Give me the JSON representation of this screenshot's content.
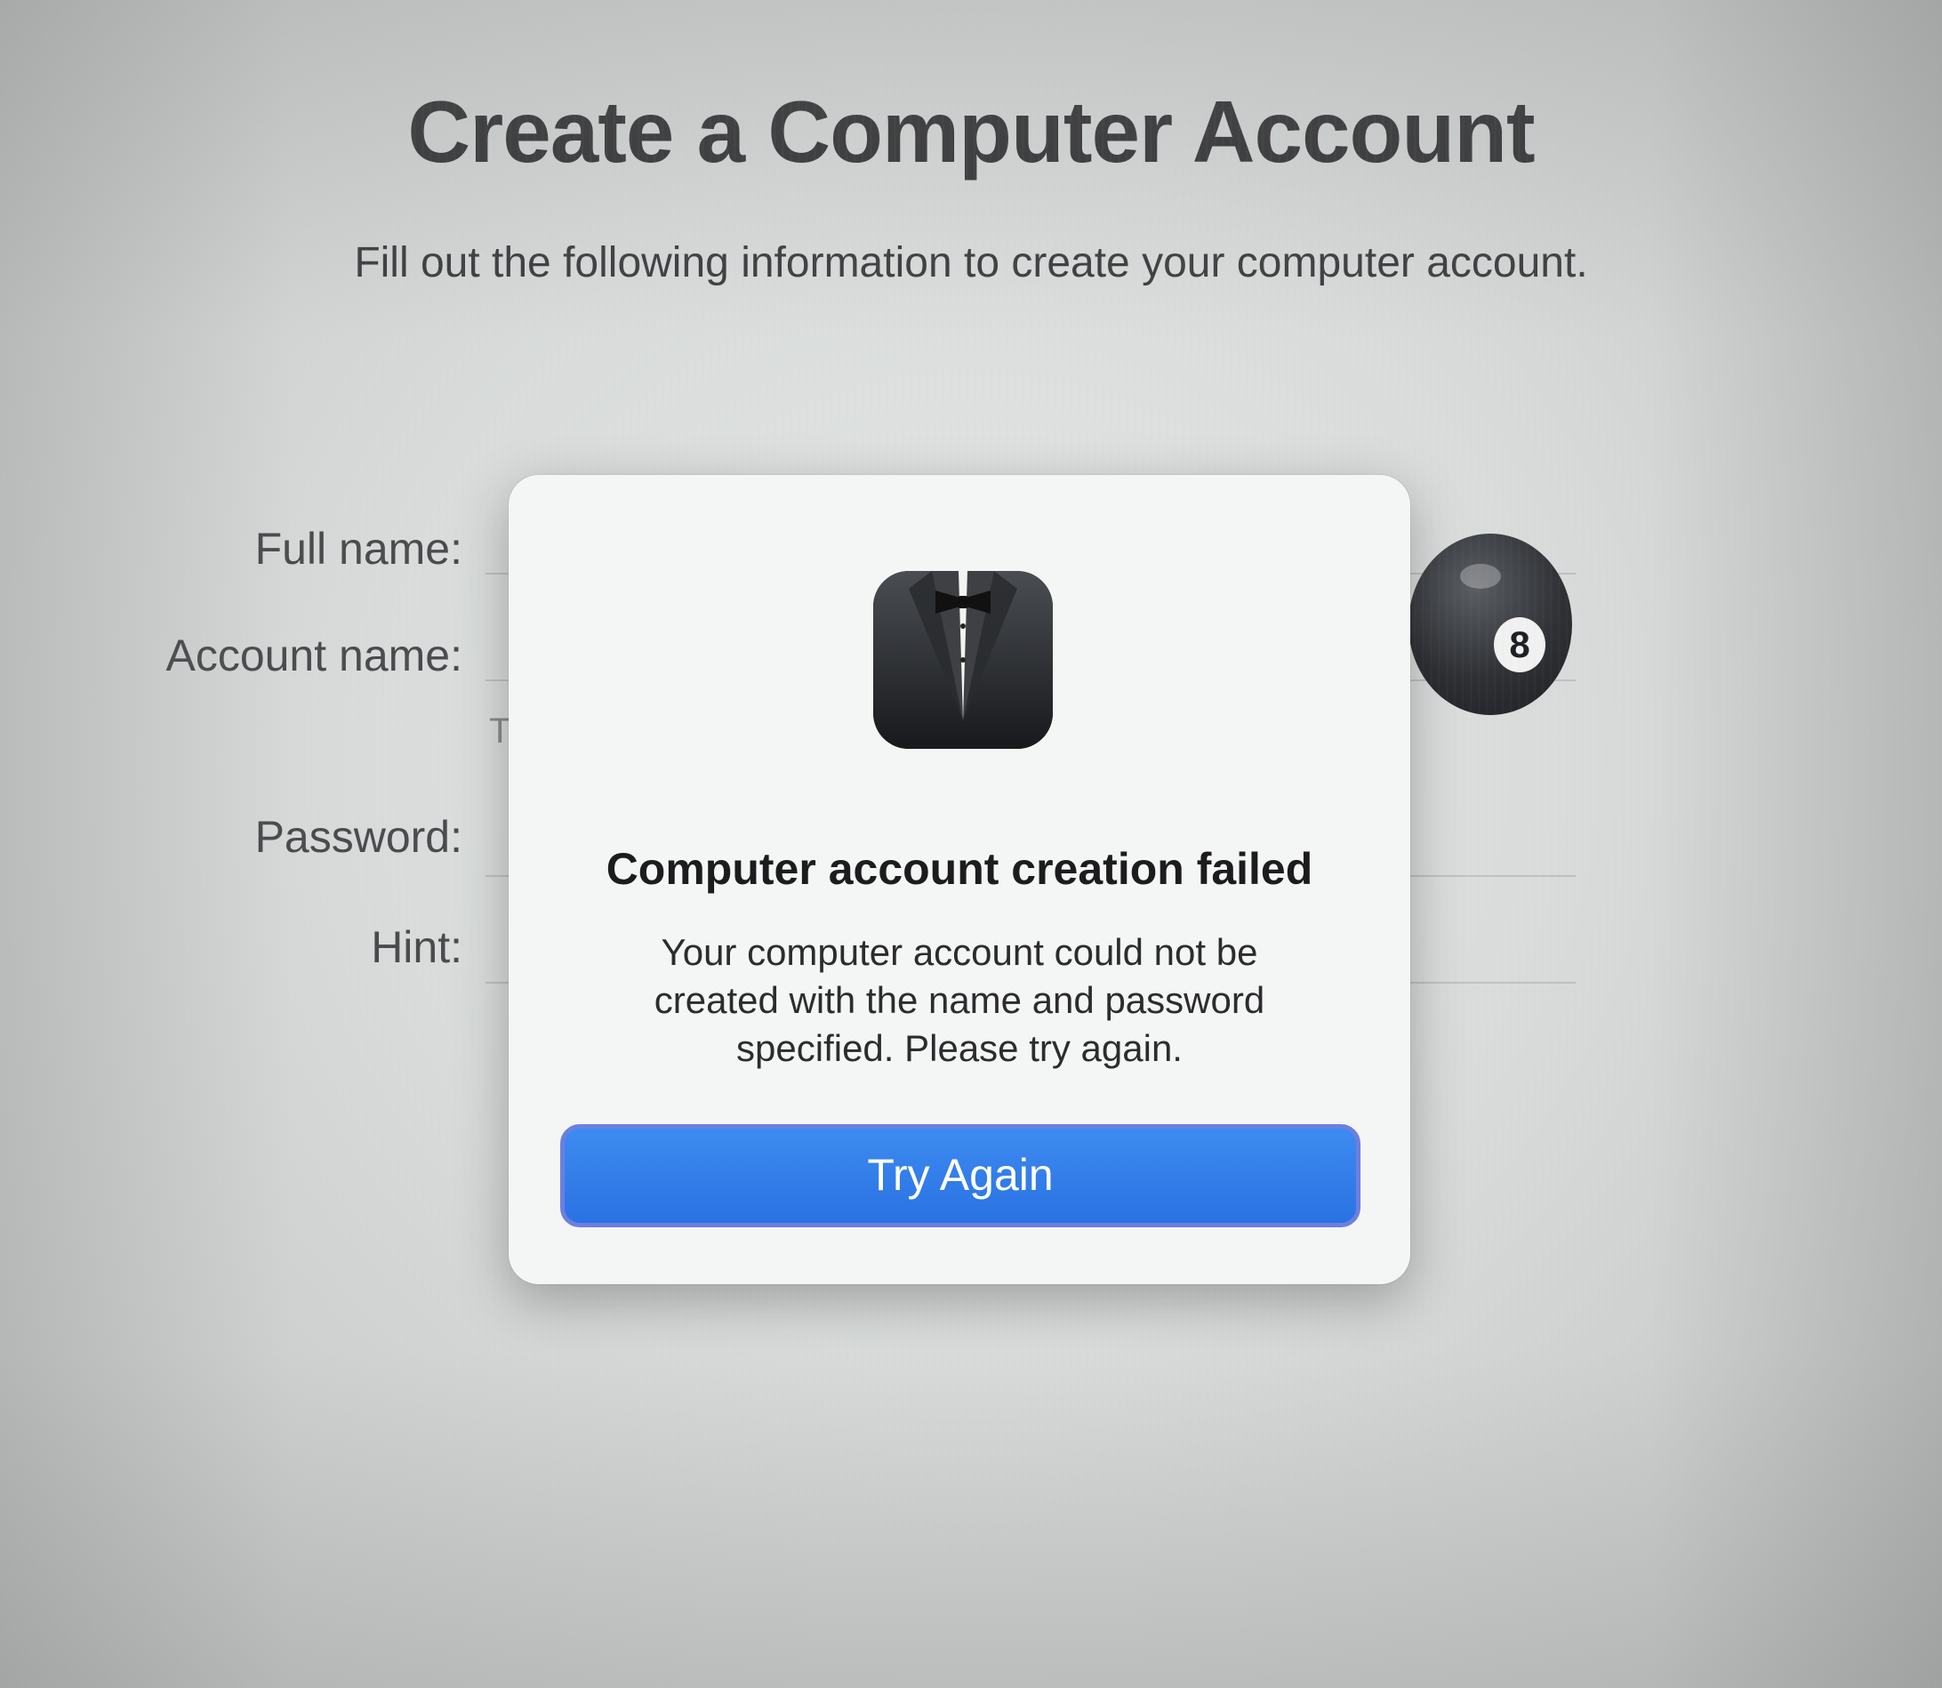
{
  "page": {
    "title": "Create a Computer Account",
    "subtitle": "Fill out the following information to create your computer account."
  },
  "form": {
    "full_name_label": "Full name:",
    "account_name_label": "Account name:",
    "account_note_partial": "T",
    "password_label": "Password:",
    "hint_label": "Hint:"
  },
  "avatar": {
    "icon": "eight-ball-icon",
    "number": "8"
  },
  "dialog": {
    "icon": "tuxedo-icon",
    "title": "Computer account creation failed",
    "message": "Your computer account could not be created with the name and password specified. Please try again.",
    "button_label": "Try Again",
    "accent_color": "#2a72e3"
  }
}
